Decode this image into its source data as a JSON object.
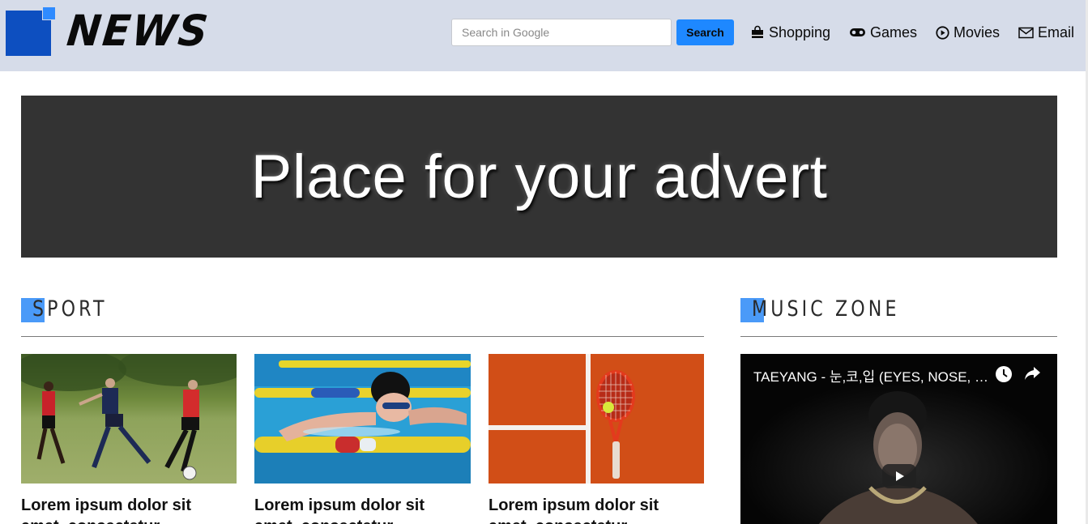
{
  "header": {
    "logo_text": "NEWS",
    "search": {
      "placeholder": "Search in Google",
      "value": "",
      "button_label": "Search"
    },
    "nav": {
      "shopping": {
        "label": "Shopping",
        "icon": "shopping-bag-icon"
      },
      "games": {
        "label": "Games",
        "icon": "gamepad-icon"
      },
      "movies": {
        "label": "Movies",
        "icon": "play-circle-icon"
      },
      "email": {
        "label": "Email",
        "icon": "envelope-icon"
      }
    }
  },
  "advert": {
    "text": "Place for your advert"
  },
  "sport": {
    "heading": "SPORT",
    "cards": [
      {
        "title": "Lorem ipsum dolor sit amet, consectetur",
        "image": "football-players-photo"
      },
      {
        "title": "Lorem ipsum dolor sit amet, consectetur",
        "image": "swimmer-photo"
      },
      {
        "title": "Lorem ipsum dolor sit amet, consectetur",
        "image": "tennis-racket-photo"
      }
    ]
  },
  "music": {
    "heading": "MUSIC ZONE",
    "video": {
      "title": "TAEYANG - 눈,코,입 (EYES, NOSE, LIPS) M/V"
    }
  },
  "colors": {
    "header_bg": "#d6dce9",
    "accent": "#4a9af8",
    "button": "#1e88ff",
    "logo_blue": "#0d4fc0",
    "advert_bg": "#333333"
  }
}
